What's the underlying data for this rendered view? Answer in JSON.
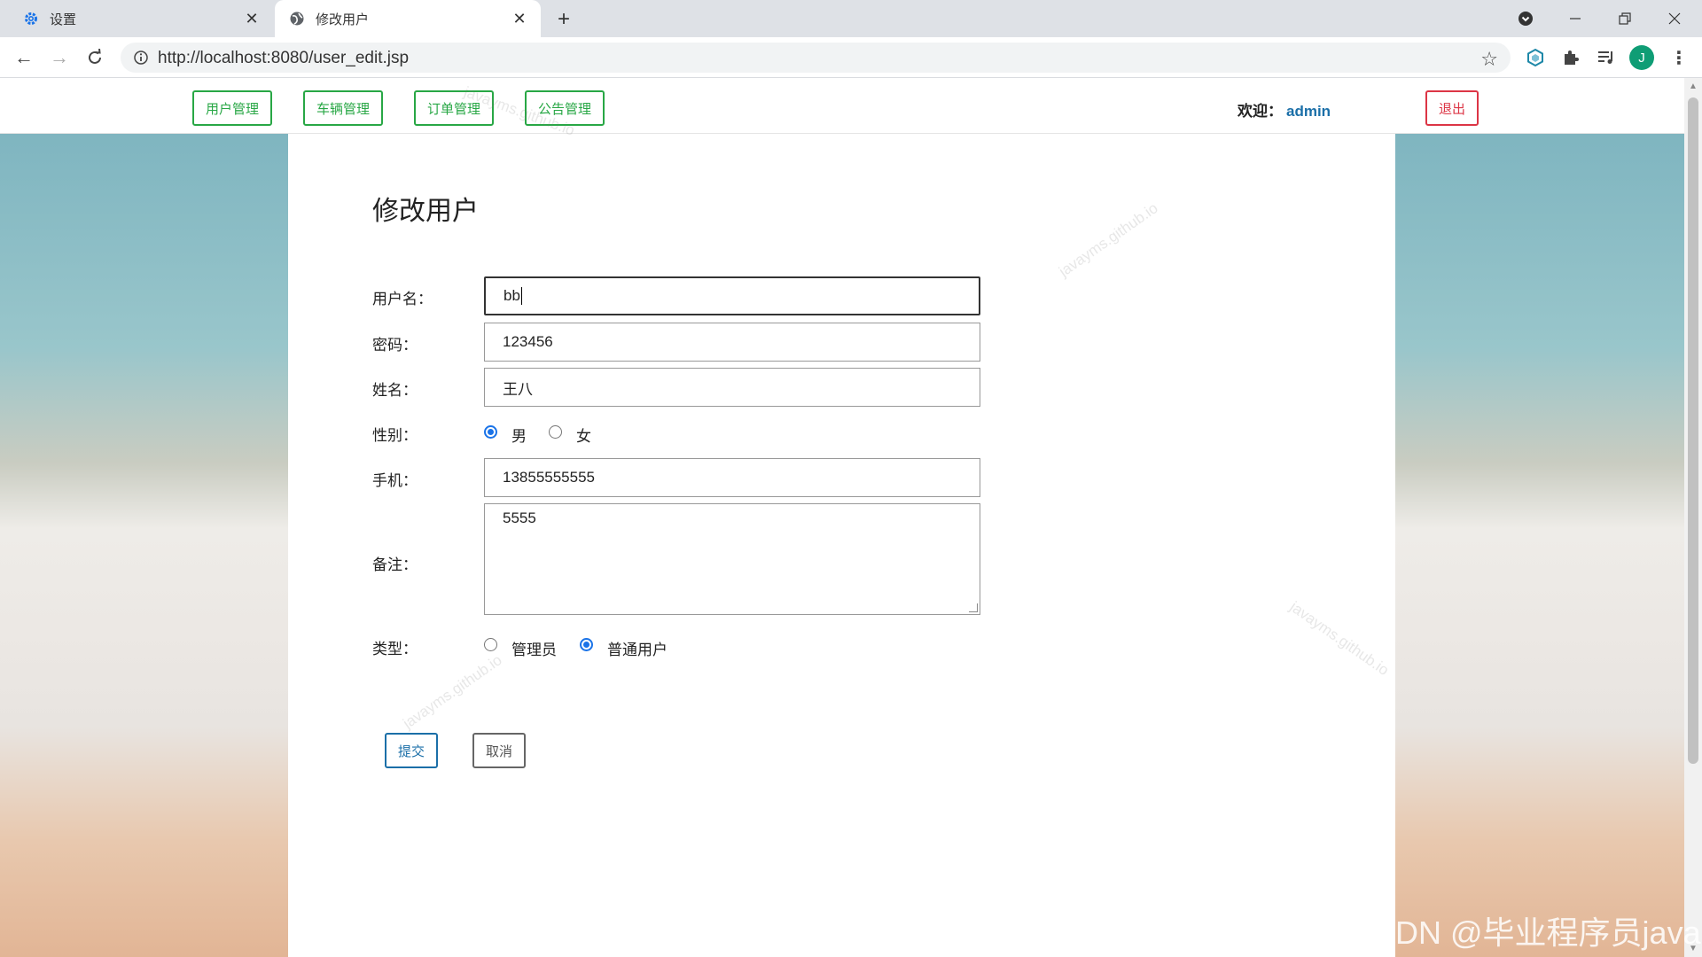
{
  "browser": {
    "tabs": [
      {
        "title": "设置",
        "icon": "gear-icon",
        "active": false
      },
      {
        "title": "修改用户",
        "icon": "globe-icon",
        "active": true
      }
    ],
    "url": "http://localhost:8080/user_edit.jsp",
    "profile_initial": "J"
  },
  "header": {
    "menu": [
      "用户管理",
      "车辆管理",
      "订单管理",
      "公告管理"
    ],
    "welcome_label": "欢迎：",
    "username": "admin",
    "logout_label": "退出"
  },
  "form": {
    "title": "修改用户",
    "fields": {
      "username": {
        "label": "用户名：",
        "value": "bb"
      },
      "password": {
        "label": "密码：",
        "value": "123456"
      },
      "name": {
        "label": "姓名：",
        "value": "王八"
      },
      "gender": {
        "label": "性别：",
        "options": [
          "男",
          "女"
        ],
        "selected": "男"
      },
      "phone": {
        "label": "手机：",
        "value": "13855555555"
      },
      "remark": {
        "label": "备注：",
        "value": "5555"
      },
      "type": {
        "label": "类型：",
        "options": [
          "管理员",
          "普通用户"
        ],
        "selected": "普通用户"
      }
    },
    "submit_label": "提交",
    "cancel_label": "取消"
  },
  "watermarks": [
    "javayms.github.io"
  ],
  "footer_mark": "CSDN @毕业程序员java",
  "colors": {
    "menu_green": "#28a745",
    "logout_red": "#dc3545",
    "submit_blue": "#1b6fa8",
    "radio_blue": "#1a73e8"
  }
}
